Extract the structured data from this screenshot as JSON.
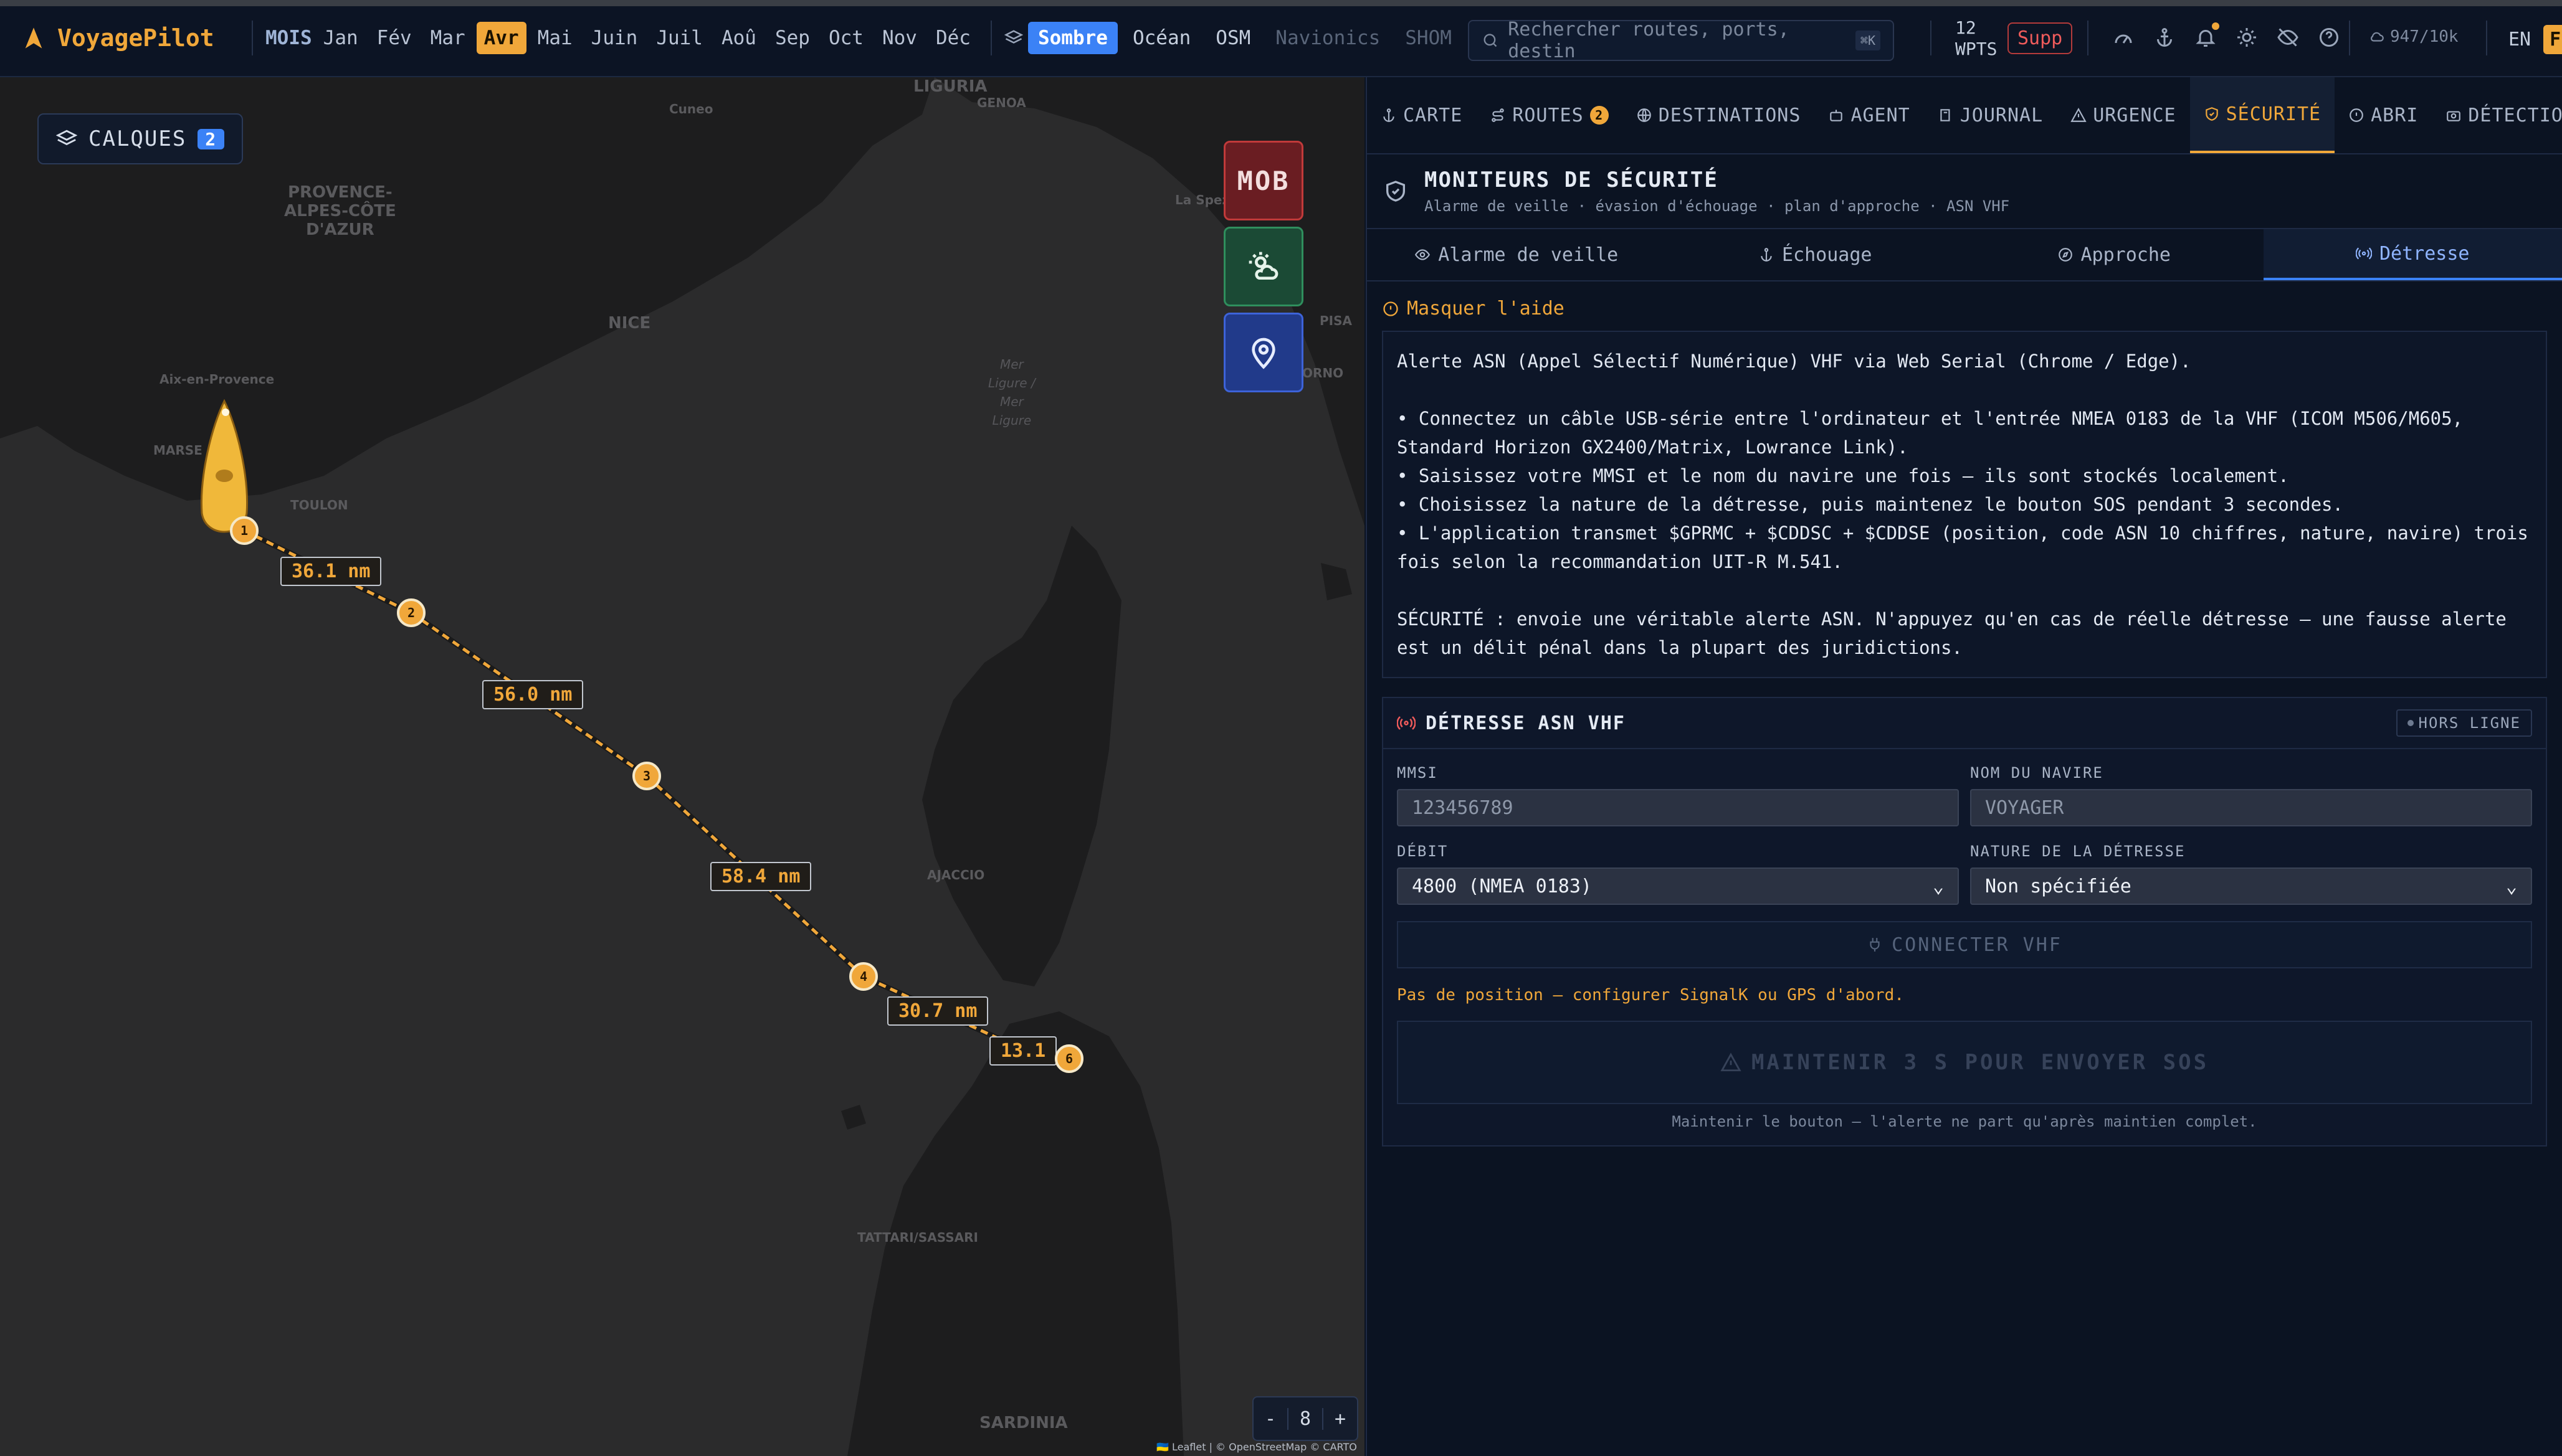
{
  "app": {
    "name": "VoyagePilot"
  },
  "months": {
    "label": "MOIS",
    "items": [
      "Jan",
      "Fév",
      "Mar",
      "Avr",
      "Mai",
      "Juin",
      "Juil",
      "Aoû",
      "Sep",
      "Oct",
      "Nov",
      "Déc"
    ],
    "active": "Avr"
  },
  "basemaps": {
    "items": [
      "Sombre",
      "Océan",
      "OSM",
      "Navionics",
      "SHOM"
    ],
    "active": "Sombre",
    "disabled": [
      "Navionics",
      "SHOM"
    ]
  },
  "search": {
    "placeholder": "Rechercher routes, ports, destin",
    "shortcut": "⌘K"
  },
  "waypoints_count": {
    "value": "12",
    "label": "WPTS"
  },
  "supp_button": "Supp",
  "storage": {
    "used": "947/10k"
  },
  "languages": {
    "items": [
      "EN",
      "FR"
    ],
    "active": "FR"
  },
  "colors": {
    "accent": "#f0a73a",
    "blue": "#3b82f6",
    "mob_red": "#c13a3a"
  },
  "map": {
    "layers_button": {
      "label": "CALQUES",
      "count": "2"
    },
    "mob_button": "MOB",
    "zoom": {
      "minus": "-",
      "level": "8",
      "plus": "+"
    },
    "attribution": "🇺🇦 Leaflet | © OpenStreetMap © CARTO",
    "place_labels": {
      "liguria": "LIGURIA",
      "genoa": "GENOA",
      "cuneo": "Cuneo",
      "provence": "PROVENCE-\nALPES-CÔTE\nD'AZUR",
      "nice": "NICE",
      "aix": "Aix-en-Provence",
      "marseille": "MARSE",
      "toulon": "TOULON",
      "sea": "Mer\nLigure /\nMer\nLigure",
      "pisa": "PISA",
      "ornp": "ORNO",
      "laspezia": "La Spezi",
      "ajaccio": "AJACCIO",
      "sassari": "TATTARI/SASSARI",
      "sardinia": "SARDINIA"
    },
    "route": {
      "waypoints": [
        "1",
        "2",
        "3",
        "4",
        "6"
      ],
      "legs": [
        "36.1 nm",
        "56.0 nm",
        "58.4 nm",
        "30.7 nm",
        "13.1"
      ]
    }
  },
  "panel": {
    "tabs": [
      {
        "label": "CARTE",
        "icon": "anchor-icon"
      },
      {
        "label": "ROUTES",
        "icon": "route-icon",
        "badge": "2"
      },
      {
        "label": "DESTINATIONS",
        "icon": "globe-icon"
      },
      {
        "label": "AGENT",
        "icon": "bot-icon"
      },
      {
        "label": "JOURNAL",
        "icon": "book-icon"
      },
      {
        "label": "URGENCE",
        "icon": "warning-icon"
      },
      {
        "label": "SÉCURITÉ",
        "icon": "shield-icon",
        "active": true
      },
      {
        "label": "ABRI",
        "icon": "info-icon"
      },
      {
        "label": "DÉTECTION",
        "icon": "camera-icon"
      }
    ],
    "header": {
      "title": "MONITEURS DE SÉCURITÉ",
      "subtitle": "Alarme de veille · évasion d'échouage · plan d'approche · ASN VHF"
    },
    "subtabs": [
      {
        "label": "Alarme de veille",
        "icon": "eye-icon"
      },
      {
        "label": "Échouage",
        "icon": "anchor-icon"
      },
      {
        "label": "Approche",
        "icon": "compass-icon"
      },
      {
        "label": "Détresse",
        "icon": "radio-icon",
        "active": true
      }
    ],
    "help_toggle": "Masquer l'aide",
    "help": {
      "intro": "Alerte ASN (Appel Sélectif Numérique) VHF via Web Serial (Chrome / Edge).",
      "bullets": [
        "• Connectez un câble USB-série entre l'ordinateur et l'entrée NMEA 0183 de la VHF (ICOM M506/M605, Standard Horizon GX2400/Matrix, Lowrance Link).",
        "• Saisissez votre MMSI et le nom du navire une fois — ils sont stockés localement.",
        "• Choisissez la nature de la détresse, puis maintenez le bouton SOS pendant 3 secondes.",
        "• L'application transmet $GPRMC + $CDDSC + $CDDSE (position, code ASN 10 chiffres, nature, navire) trois fois selon la recommandation UIT-R M.541."
      ],
      "warning": "SÉCURITÉ : envoie une véritable alerte ASN. N'appuyez qu'en cas de réelle détresse — une fausse alerte est un délit pénal dans la plupart des juridictions."
    },
    "distress": {
      "title": "DÉTRESSE ASN VHF",
      "status": "HORS LIGNE",
      "mmsi": {
        "label": "MMSI",
        "placeholder": "123456789"
      },
      "vessel": {
        "label": "NOM DU NAVIRE",
        "placeholder": "VOYAGER"
      },
      "baud": {
        "label": "DÉBIT",
        "value": "4800 (NMEA 0183)"
      },
      "nature": {
        "label": "NATURE DE LA DÉTRESSE",
        "value": "Non spécifiée"
      },
      "connect": "CONNECTER VHF",
      "no_position": "Pas de position — configurer SignalK ou GPS d'abord.",
      "sos": "MAINTENIR 3 S POUR ENVOYER SOS",
      "sos_hint": "Maintenir le bouton — l'alerte ne part qu'après maintien complet."
    }
  }
}
